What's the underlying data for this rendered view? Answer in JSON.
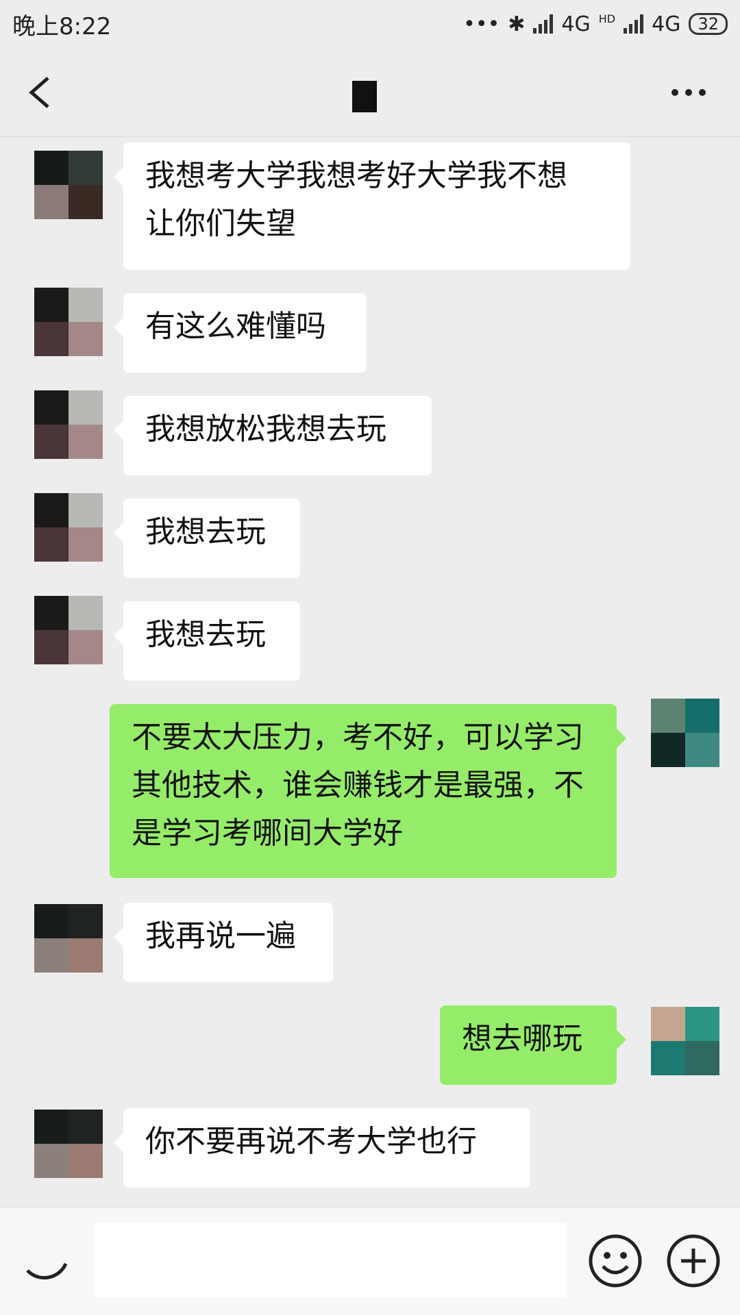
{
  "status_bar": {
    "time": "晚上8:22",
    "network_1": "4G",
    "hd_label": "HD",
    "network_2": "4G",
    "battery": "32"
  },
  "header": {
    "back_icon": "chevron-left-icon",
    "more_icon": "more-horizontal-icon"
  },
  "messages": [
    {
      "side": "in",
      "text_lines": [
        "我想考大学我想考好大学我不想",
        "让你们失望"
      ]
    },
    {
      "side": "in",
      "text": "有这么难懂吗"
    },
    {
      "side": "in",
      "text": "我想放松我想去玩"
    },
    {
      "side": "in",
      "text": "我想去玩"
    },
    {
      "side": "in",
      "text": "我想去玩"
    },
    {
      "side": "out",
      "text_lines": [
        "不要太大压力，考不好，可以学习",
        "其他技术，谁会赚钱才是最强，不",
        "是学习考哪间大学好"
      ]
    },
    {
      "side": "in",
      "text": "我再说一遍"
    },
    {
      "side": "out",
      "text": "想去哪玩"
    },
    {
      "side": "in",
      "text": "你不要再说不考大学也行"
    }
  ],
  "input_bar": {
    "placeholder": "",
    "voice_icon": "voice-icon",
    "emoji_icon": "emoji-icon",
    "plus_icon": "plus-circle-icon"
  },
  "colors": {
    "background": "#ededed",
    "incoming_bubble": "#ffffff",
    "outgoing_bubble": "#95ec69"
  }
}
